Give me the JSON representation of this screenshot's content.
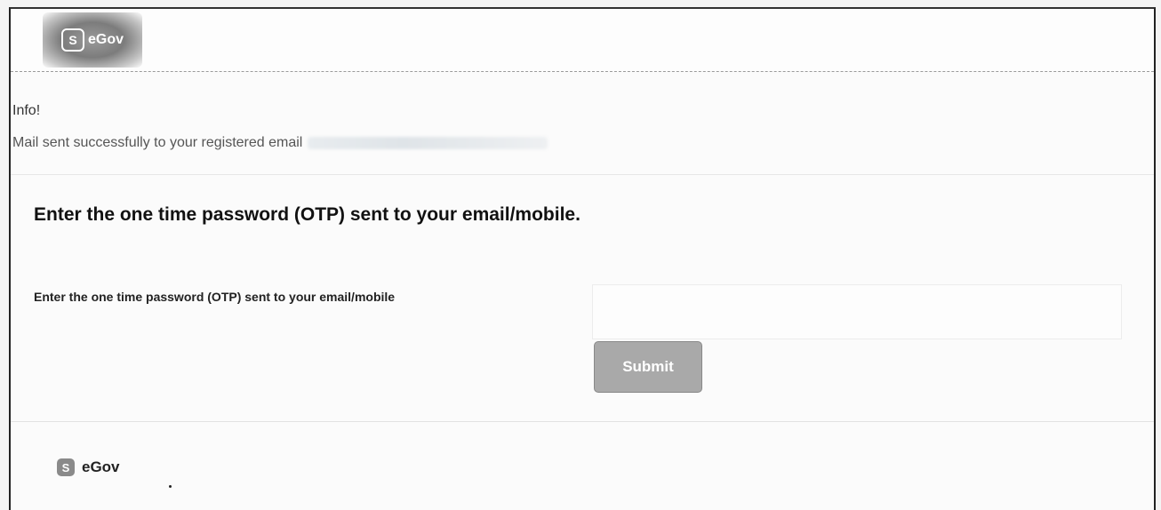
{
  "header": {
    "logo_badge": "S",
    "logo_text": "eGov",
    "logo_icon": "shield-s-icon"
  },
  "info": {
    "title": "Info!",
    "message": "Mail sent successfully to your registered email"
  },
  "main": {
    "heading": "Enter the one time password (OTP) sent to your email/mobile.",
    "otp_label": "Enter the one time password (OTP) sent to your email/mobile",
    "otp_value": "",
    "submit_label": "Submit"
  },
  "footer": {
    "logo_badge": "S",
    "logo_text": "eGov"
  },
  "colors": {
    "button_bg": "#a9a9a9",
    "logo_bg": "#7c7c7c"
  }
}
